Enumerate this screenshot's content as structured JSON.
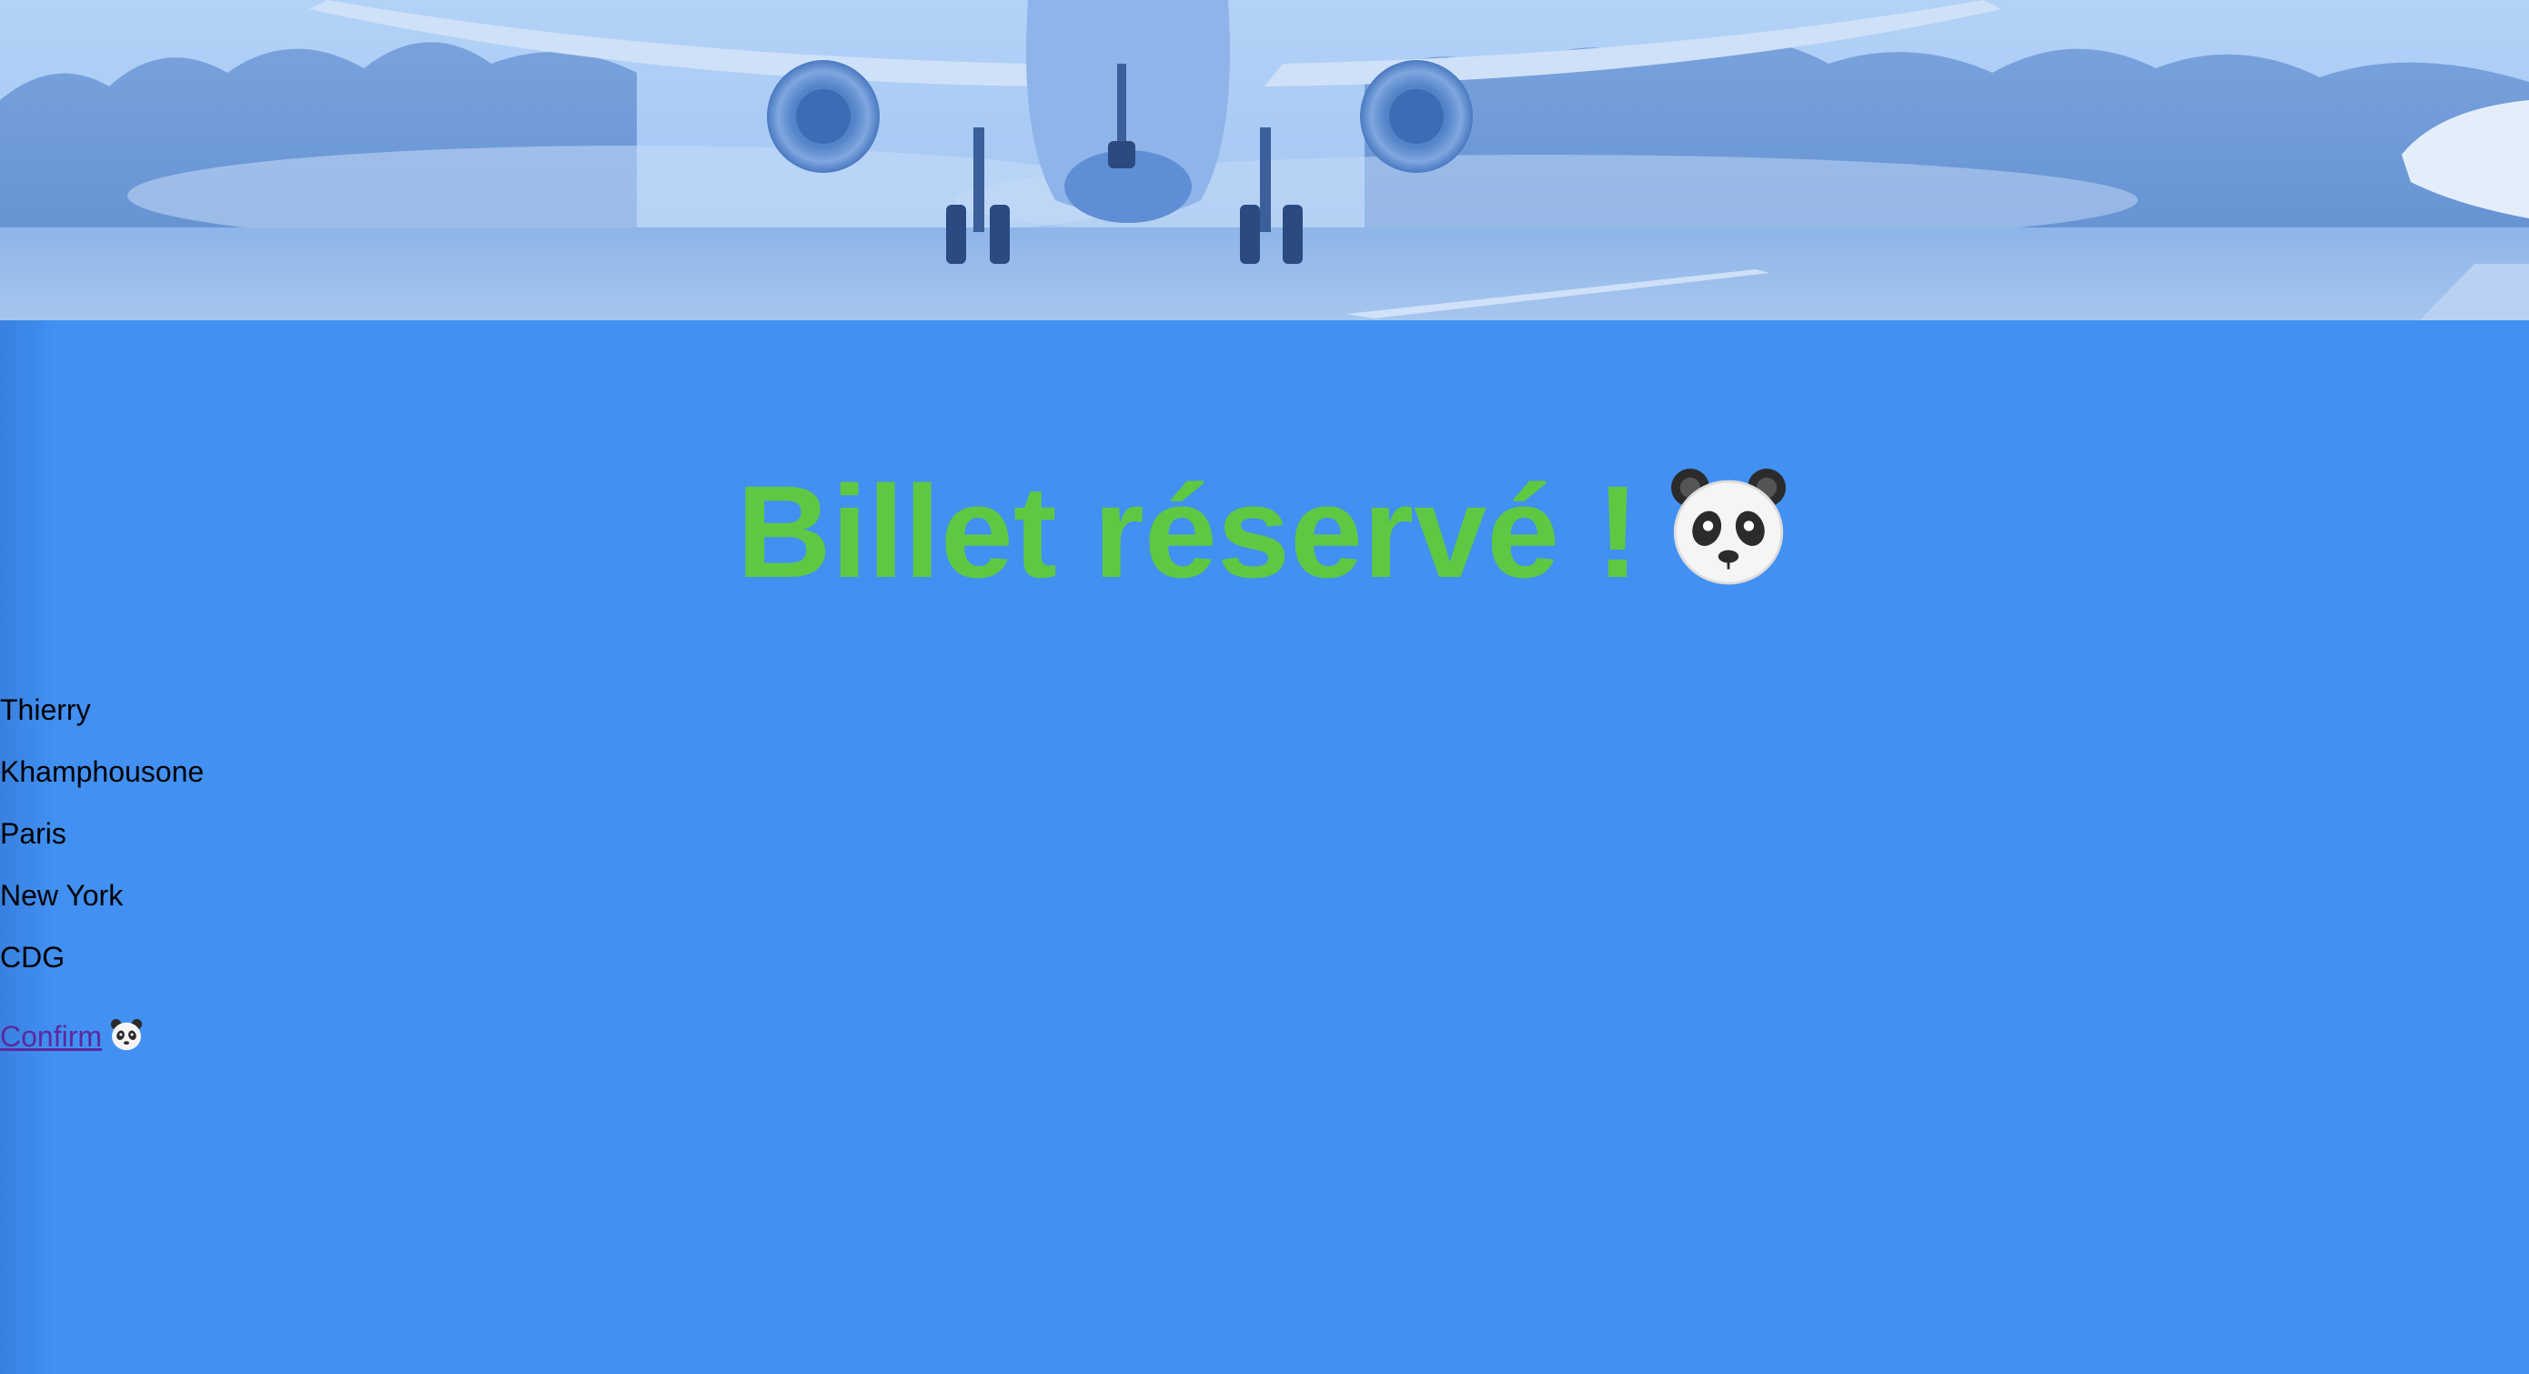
{
  "header": {
    "hero_image": "airplane-landing-banner"
  },
  "main": {
    "title": "Billet réservé !",
    "title_icon": "panda-icon",
    "title_color": "#5fc843",
    "background_color": "#4190f2",
    "details": [
      "Thierry",
      "Khamphousone",
      "Paris",
      "New York",
      "CDG"
    ],
    "confirm_label": "Confirm",
    "confirm_icon": "panda-icon",
    "link_color": "#5b2a9f"
  }
}
